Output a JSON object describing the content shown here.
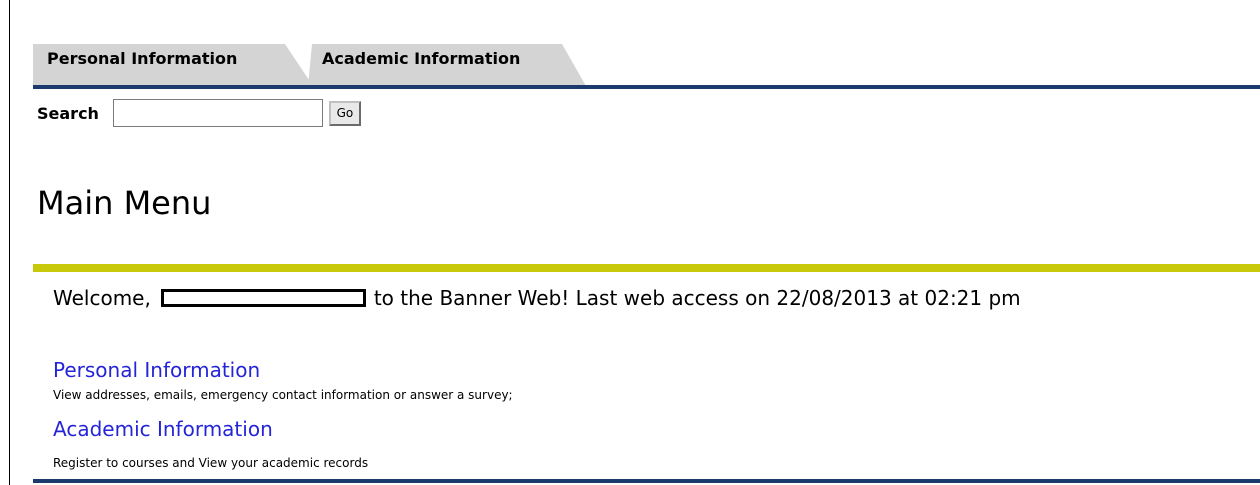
{
  "tabs": [
    {
      "label": "Personal Information"
    },
    {
      "label": "Academic Information"
    }
  ],
  "search": {
    "label": "Search",
    "value": "",
    "button_label": "Go"
  },
  "page_title": "Main Menu",
  "welcome": {
    "prefix": "Welcome,",
    "suffix": "to the Banner Web! Last web access on 22/08/2013 at 02:21 pm"
  },
  "menu": [
    {
      "label": "Personal Information",
      "description": "View addresses, emails, emergency contact information or answer a survey;"
    },
    {
      "label": "Academic Information",
      "description": "Register to courses and View your academic records"
    }
  ],
  "colors": {
    "nav_rule": "#1b3b6f",
    "title_rule": "#c7c90a",
    "link": "#2525d8",
    "tab_bg": "#d4d4d4"
  }
}
